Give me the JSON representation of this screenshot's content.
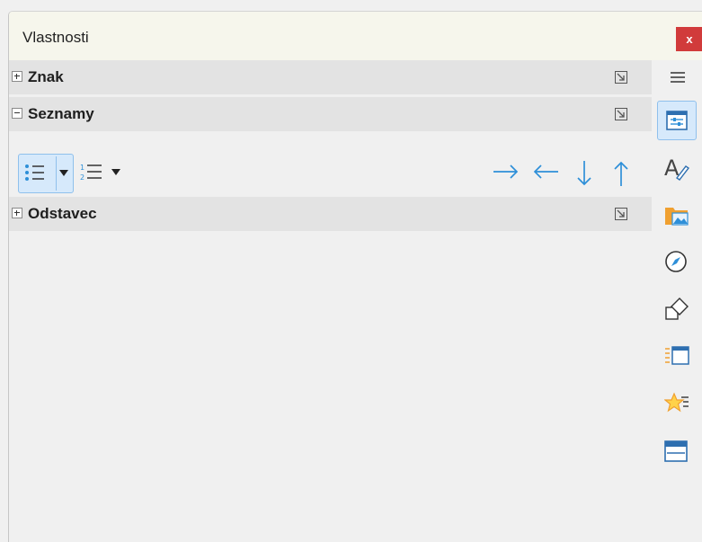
{
  "window": {
    "title": "Vlastnosti",
    "close_label": "x"
  },
  "sections": [
    {
      "label": "Znak",
      "state": "collapsed",
      "expander_icon": "plus-box-icon"
    },
    {
      "label": "Seznamy",
      "state": "expanded",
      "expander_icon": "minus-box-icon"
    },
    {
      "label": "Odstavec",
      "state": "collapsed",
      "expander_icon": "plus-box-icon"
    }
  ],
  "lists_toolbar": {
    "left": [
      {
        "name": "unordered-list-icon",
        "active": true
      },
      {
        "name": "dropdown-arrow-icon"
      },
      {
        "name": "ordered-list-icon"
      },
      {
        "name": "dropdown-arrow-icon"
      }
    ],
    "right": [
      {
        "name": "demote-arrow-right-icon"
      },
      {
        "name": "promote-arrow-left-icon"
      },
      {
        "name": "move-down-arrow-icon"
      },
      {
        "name": "move-up-arrow-icon"
      }
    ]
  },
  "sidebar": {
    "menu_icon": "hamburger-menu-icon",
    "decks": [
      {
        "name": "properties-icon",
        "active": true
      },
      {
        "name": "styles-icon"
      },
      {
        "name": "gallery-icon"
      },
      {
        "name": "navigator-icon"
      },
      {
        "name": "shapes-icon"
      },
      {
        "name": "slide-transition-icon"
      },
      {
        "name": "animation-icon"
      },
      {
        "name": "master-slides-icon"
      }
    ]
  },
  "colors": {
    "accent_blue": "#2e8fd8",
    "close_red": "#d13b3b",
    "orange": "#f0a030"
  }
}
